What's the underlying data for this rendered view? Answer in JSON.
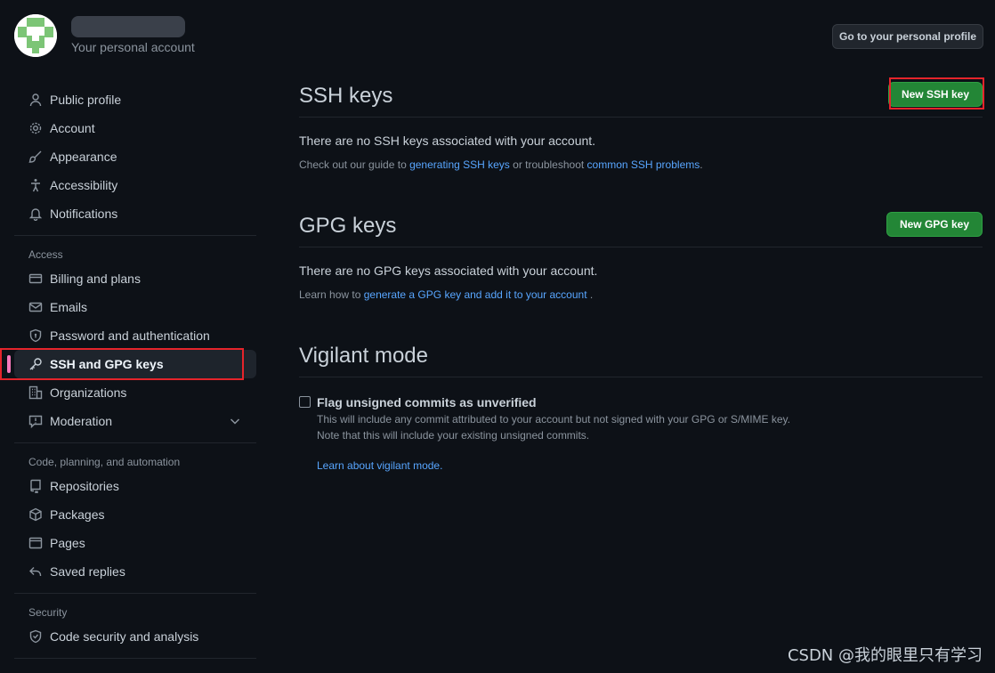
{
  "header": {
    "account_name": "",
    "account_subtitle": "Your personal account",
    "profile_button": "Go to your personal profile"
  },
  "sidebar": {
    "top_items": [
      {
        "label": "Public profile",
        "icon": "person-icon"
      },
      {
        "label": "Account",
        "icon": "gear-icon"
      },
      {
        "label": "Appearance",
        "icon": "paintbrush-icon"
      },
      {
        "label": "Accessibility",
        "icon": "accessibility-icon"
      },
      {
        "label": "Notifications",
        "icon": "bell-icon"
      }
    ],
    "access_label": "Access",
    "access_items": [
      {
        "label": "Billing and plans",
        "icon": "credit-card-icon"
      },
      {
        "label": "Emails",
        "icon": "mail-icon"
      },
      {
        "label": "Password and authentication",
        "icon": "shield-icon"
      },
      {
        "label": "SSH and GPG keys",
        "icon": "key-icon",
        "active": true
      },
      {
        "label": "Organizations",
        "icon": "organization-icon"
      },
      {
        "label": "Moderation",
        "icon": "report-icon"
      }
    ],
    "code_label": "Code, planning, and automation",
    "code_items": [
      {
        "label": "Repositories",
        "icon": "repo-icon"
      },
      {
        "label": "Packages",
        "icon": "package-icon"
      },
      {
        "label": "Pages",
        "icon": "browser-icon"
      },
      {
        "label": "Saved replies",
        "icon": "reply-icon"
      }
    ],
    "security_label": "Security",
    "security_items": [
      {
        "label": "Code security and analysis",
        "icon": "shield-lock-icon"
      }
    ]
  },
  "ssh": {
    "title": "SSH keys",
    "button": "New SSH key",
    "empty": "There are no SSH keys associated with your account.",
    "help_prefix": "Check out our guide to ",
    "help_link1": "generating SSH keys",
    "help_mid": " or troubleshoot ",
    "help_link2": "common SSH problems",
    "help_suffix": "."
  },
  "gpg": {
    "title": "GPG keys",
    "button": "New GPG key",
    "empty": "There are no GPG keys associated with your account.",
    "help_prefix": "Learn how to ",
    "help_link": "generate a GPG key and add it to your account",
    "help_suffix": " ."
  },
  "vigilant": {
    "title": "Vigilant mode",
    "checkbox_label": "Flag unsigned commits as unverified",
    "desc_line1": "This will include any commit attributed to your account but not signed with your GPG or S/MIME key.",
    "desc_line2": "Note that this will include your existing unsigned commits.",
    "link": "Learn about vigilant mode."
  },
  "watermark": "CSDN @我的眼里只有学习",
  "colors": {
    "background": "#0d1117",
    "link": "#58a6ff",
    "green_button": "#238636",
    "active_indicator": "#f778ba",
    "annotation_red": "#e5242b"
  }
}
